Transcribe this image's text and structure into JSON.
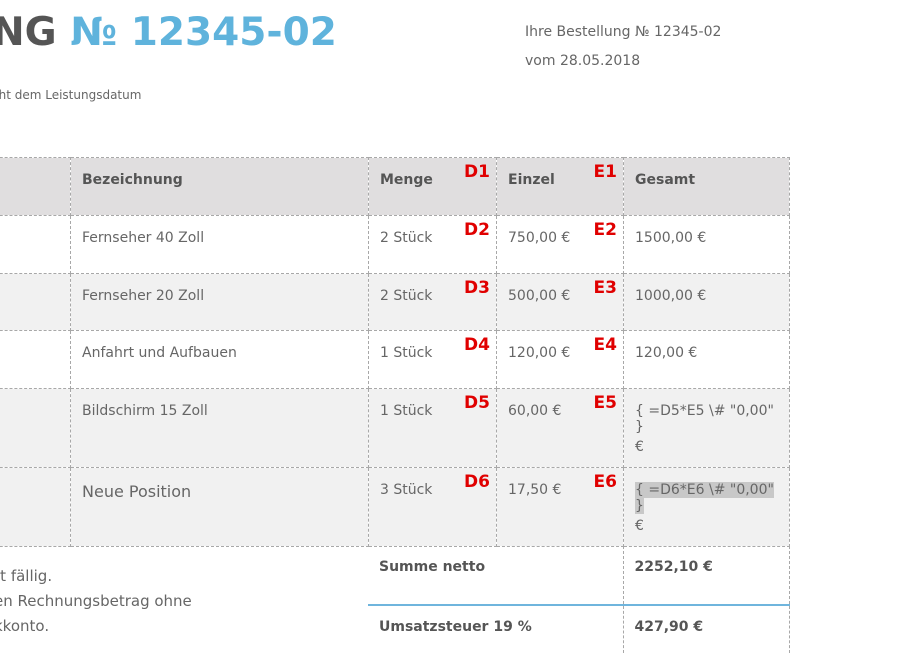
{
  "header": {
    "title_left": "NG",
    "title_number": "№ 12345-02",
    "order_line": "Ihre Bestellung № 12345-02",
    "date_line": "vom 28.05.2018",
    "subtitle": "cht dem Leistungsdatum"
  },
  "table": {
    "columns": [
      "",
      "Bezeichnung",
      "Menge",
      "Einzel",
      "Gesamt"
    ],
    "header_labels": {
      "menge": "D1",
      "einzel": "E1"
    },
    "rows": [
      {
        "bezeichnung": "Fernseher 40 Zoll",
        "menge": "2 Stück",
        "einzel": "750,00 €",
        "gesamt": "1500,00 €",
        "d_label": "D2",
        "e_label": "E2"
      },
      {
        "bezeichnung": "Fernseher 20 Zoll",
        "menge": "2 Stück",
        "einzel": "500,00 €",
        "gesamt": "1000,00 €",
        "d_label": "D3",
        "e_label": "E3"
      },
      {
        "bezeichnung": "Anfahrt und Aufbauen",
        "menge": "1 Stück",
        "einzel": "120,00 €",
        "gesamt": "120,00 €",
        "d_label": "D4",
        "e_label": "E4"
      },
      {
        "bezeichnung": "Bildschirm 15 Zoll",
        "menge": "1 Stück",
        "einzel": "60,00 €",
        "gesamt_field": "{ =D5*E5 \\# \"0,00\" }",
        "gesamt_unit": "€",
        "d_label": "D5",
        "e_label": "E5"
      },
      {
        "bezeichnung": "Neue Position",
        "menge": "3 Stück",
        "einzel": "17,50 €",
        "gesamt_field": "{ =D6*E6 \\# \"0,00\" }",
        "gesamt_unit": "€",
        "d_label": "D6",
        "e_label": "E6"
      }
    ]
  },
  "notes": [
    "rt fällig.",
    "en Rechnungsbetrag ohne",
    "kkonto."
  ],
  "sums": {
    "netto_label": "Summe netto",
    "netto_value": "2252,10 €",
    "ust_label": "Umsatzsteuer 19 %",
    "ust_value": "427,90 €"
  }
}
